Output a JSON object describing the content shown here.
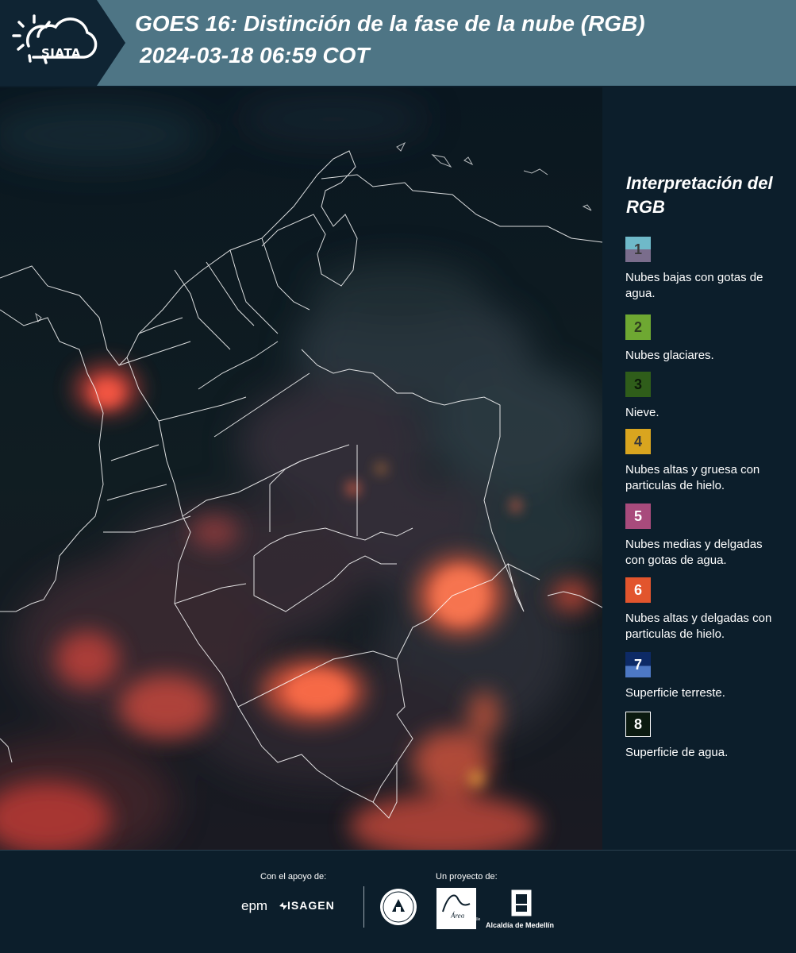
{
  "header": {
    "logo_text": "SIATA",
    "title": "GOES 16: Distinción de la fase de la nube (RGB)",
    "timestamp": "2024-03-18 06:59 COT",
    "banner_color": "#4e7585",
    "header_dark_color": "#0f2433"
  },
  "legend": {
    "title": "Interpretación del RGB",
    "items": [
      {
        "number": "1",
        "label": "Nubes bajas con gotas de agua.",
        "colors": [
          "#6fb9c9",
          "#7a6d8c"
        ]
      },
      {
        "number": "2",
        "label": "Nubes glaciares.",
        "colors": [
          "#6ea832"
        ]
      },
      {
        "number": "3",
        "label": "Nieve.",
        "colors": [
          "#2f5d1a"
        ]
      },
      {
        "number": "4",
        "label": "Nubes altas y gruesa con particulas de hielo.",
        "colors": [
          "#d9a51f"
        ]
      },
      {
        "number": "5",
        "label": "Nubes medias y delgadas con gotas de agua.",
        "colors": [
          "#a84b7c"
        ]
      },
      {
        "number": "6",
        "label": "Nubes altas y delgadas con particulas de hielo.",
        "colors": [
          "#e2552d"
        ]
      },
      {
        "number": "7",
        "label": "Superficie terreste.",
        "colors": [
          "#0d2a66",
          "#4d78c4"
        ]
      },
      {
        "number": "8",
        "label": "Superficie de agua.",
        "colors": [
          "#0b1a10"
        ]
      }
    ]
  },
  "footer": {
    "support_label": "Con el apoyo de:",
    "project_label": "Un proyecto de:",
    "epm": "epm",
    "isagen": "ISAGEN",
    "area_text": "METROPOLITANA Valle de Aburrá",
    "alcaldia": "Alcaldía de Medellín"
  }
}
